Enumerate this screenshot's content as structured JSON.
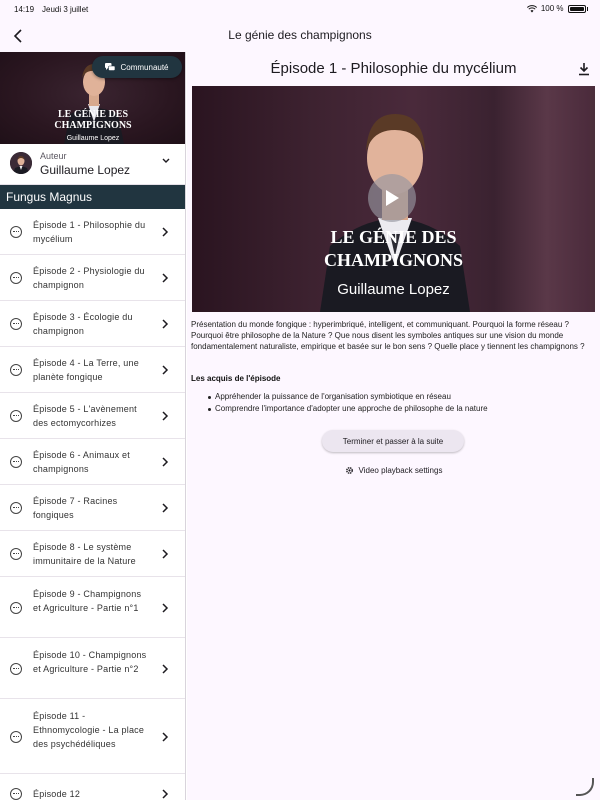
{
  "status_bar": {
    "time": "14:19",
    "date": "Jeudi 3 juillet",
    "battery": "100 %"
  },
  "app_bar": {
    "title": "Le génie des champignons",
    "back_icon": "chevron-left-icon"
  },
  "sidebar": {
    "cover": {
      "title_line1": "LE GÉNIE DES",
      "title_line2": "CHAMPIGNONS",
      "author": "Guillaume Lopez",
      "community_label": "Communauté",
      "community_icon": "chat-bubbles-icon"
    },
    "author": {
      "label": "Auteur",
      "name": "Guillaume Lopez"
    },
    "section_title": "Fungus Magnus",
    "episodes": [
      {
        "label": "Épisode 1 - Philosophie du mycélium"
      },
      {
        "label": "Épisode 2 - Physiologie du champignon"
      },
      {
        "label": "Épisode 3 - Écologie du champignon"
      },
      {
        "label": "Épisode 4 - La Terre, une planète fongique"
      },
      {
        "label": "Épisode 5 - L'avènement des ectomycorhizes"
      },
      {
        "label": "Épisode 6 - Animaux et champignons"
      },
      {
        "label": "Épisode 7 - Racines fongiques"
      },
      {
        "label": "Épisode 8 - Le système immunitaire de la Nature"
      },
      {
        "label": "Épisode 9 - Champignons et Agriculture - Partie n°1"
      },
      {
        "label": "Épisode 10 - Champignons et Agriculture - Partie n°2"
      },
      {
        "label": "Épisode 11 - Ethnomycologie - La place des psychédéliques"
      },
      {
        "label": "Épisode 12"
      }
    ]
  },
  "main": {
    "episode_title": "Épisode 1 - Philosophie du mycélium",
    "download_icon": "download-icon",
    "video": {
      "title_line1": "LE GÉNIE DES",
      "title_line2": "CHAMPIGNONS",
      "author": "Guillaume Lopez",
      "play_icon": "play-icon"
    },
    "description": "Présentation du monde fongique : hyperimbriqué, intelligent, et communiquant. Pourquoi la forme réseau ? Pourquoi être philosophe de la Nature ? Que nous disent les symboles antiques sur une vision du monde fondamentalement naturaliste, empirique et basée sur le bon sens ? Quelle place y tiennent les champignons ?",
    "acquis_title": "Les acquis de l'épisode",
    "acquis": [
      "Appréhender la puissance de l'organisation symbiotique en réseau",
      "Comprendre l'importance d'adopter une approche de philosophe de la nature"
    ],
    "next_button": "Terminer et passer à la suite",
    "settings_label": "Video playback settings",
    "settings_icon": "gear-icon"
  }
}
